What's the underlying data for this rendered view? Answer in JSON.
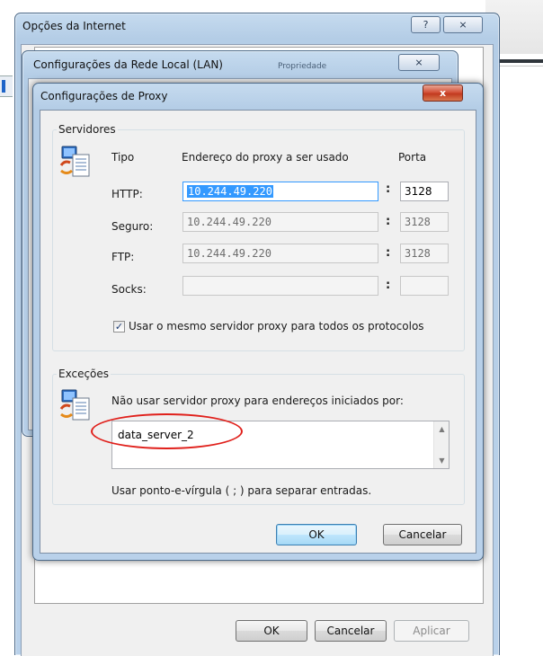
{
  "inet_window": {
    "title": "Opções da Internet",
    "help_button": "?",
    "close_button": "⨯",
    "buttons": {
      "ok": "OK",
      "cancel": "Cancelar",
      "apply": "Aplicar"
    }
  },
  "lan_window": {
    "title": "Configurações da Rede Local (LAN)",
    "close_button": "⨯",
    "behind_tab_text": "Propriedade"
  },
  "proxy_window": {
    "title": "Configurações de Proxy",
    "close_button": "x",
    "servers": {
      "legend": "Servidores",
      "col_type": "Tipo",
      "col_address": "Endereço do proxy a ser usado",
      "col_port": "Porta",
      "rows": [
        {
          "label": "HTTP:",
          "address": "10.244.49.220",
          "port": "3128",
          "enabled": true
        },
        {
          "label": "Seguro:",
          "address": "10.244.49.220",
          "port": "3128",
          "enabled": false
        },
        {
          "label": "FTP:",
          "address": "10.244.49.220",
          "port": "3128",
          "enabled": false
        },
        {
          "label": "Socks:",
          "address": "",
          "port": "",
          "enabled": false
        }
      ],
      "same_server_checkbox": "Usar o mesmo servidor proxy para todos os protocolos",
      "same_server_checked": true
    },
    "exceptions": {
      "legend": "Exceções",
      "description": "Não usar servidor proxy para endereços iniciados por:",
      "value": "data_server_2",
      "hint": "Usar ponto-e-vírgula ( ; ) para separar entradas."
    },
    "buttons": {
      "ok": "OK",
      "cancel": "Cancelar"
    }
  },
  "colors": {
    "frame": "#b9d1ea",
    "highlight_selection": "#3399ff",
    "annotation_circle": "#e0201b"
  }
}
